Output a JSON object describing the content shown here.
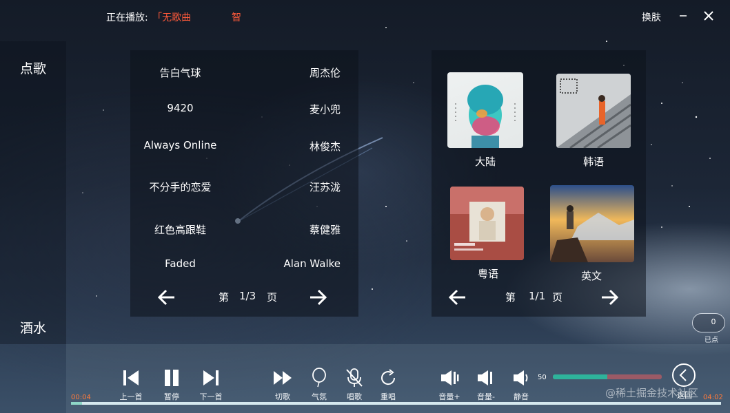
{
  "header": {
    "now_playing_label": "正在播放:",
    "now_playing_song": "「无歌曲",
    "now_playing_song_tail": "智",
    "skin_button": "换肤"
  },
  "side_menu": {
    "items": [
      {
        "label": "点歌"
      },
      {
        "label": "酒水"
      }
    ]
  },
  "song_list": {
    "songs": [
      {
        "name": "告白气球",
        "artist": "周杰伦"
      },
      {
        "name": "9420",
        "artist": "麦小兜"
      },
      {
        "name": "Always Online",
        "artist": "林俊杰"
      },
      {
        "name": "不分手的恋爱",
        "artist": "汪苏泷"
      },
      {
        "name": "红色高跟鞋",
        "artist": "蔡健雅"
      },
      {
        "name": "Faded",
        "artist": "Alan Walke"
      }
    ],
    "pager": {
      "prefix": "第",
      "value": "1/3",
      "suffix": "页"
    }
  },
  "categories": {
    "items": [
      {
        "label": "大陆"
      },
      {
        "label": "韩语"
      },
      {
        "label": "粤语"
      },
      {
        "label": "英文"
      }
    ],
    "pager": {
      "prefix": "第",
      "value": "1/1",
      "suffix": "页"
    }
  },
  "points": {
    "value": "0",
    "label": "已点"
  },
  "player": {
    "controls": {
      "prev": "上一首",
      "pause": "暂停",
      "next": "下一首",
      "skip": "切歌",
      "atmosphere": "气氛",
      "vocal": "唱歌",
      "replay": "重唱",
      "vol_up": "音量+",
      "vol_down": "音量-",
      "mute": "静音",
      "back": "返回"
    },
    "volume": "50",
    "volume_level": 0.5,
    "time_current": "00:04",
    "time_total": "04:02",
    "progress_fraction": 0.0165
  },
  "watermark": "@稀土掘金技术社区",
  "colors": {
    "accent": "#ff5a3a",
    "volume_fill": "#2eb39b",
    "volume_track": "#9b5a66"
  }
}
